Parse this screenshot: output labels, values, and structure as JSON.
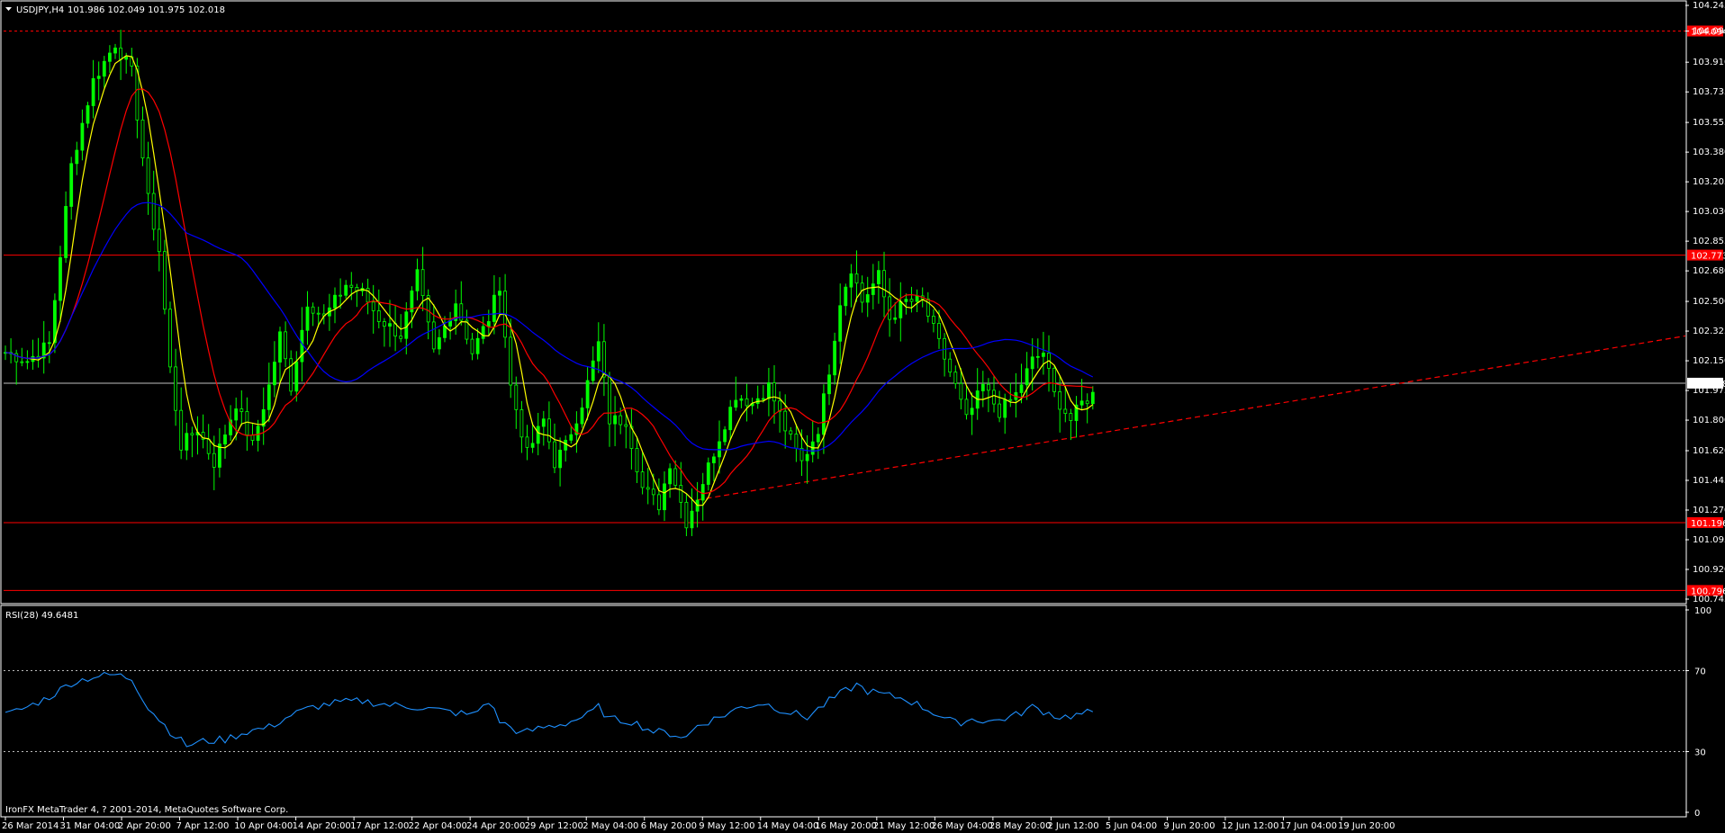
{
  "header": {
    "symbol_label": "USDJPY,H4",
    "ohlc_label": "101.986 102.049 101.975 102.018",
    "menu_icon": "triangle-down-icon"
  },
  "rsi_header": {
    "label": "RSI(28) 49.6481"
  },
  "copyright": "IronFX MetaTrader 4, ? 2001-2014, MetaQuotes Software Corp.",
  "colors": {
    "background": "#000000",
    "axis": "#ffffff",
    "bull_candle": "#00ff00",
    "ma_fast": "#ffff00",
    "ma_mid": "#ff0000",
    "ma_slow": "#0000ff",
    "rsi_line": "#1e90ff",
    "level_line": "#ff0000",
    "price_line": "#c0c0c0"
  },
  "chart_data": [
    {
      "type": "candlestick",
      "symbol": "USDJPY",
      "timeframe": "H4",
      "price_scale": [
        "104.245",
        "104.094",
        "103.910",
        "103.735",
        "103.555",
        "103.380",
        "103.205",
        "103.030",
        "102.855",
        "102.680",
        "102.500",
        "102.325",
        "102.150",
        "101.975",
        "101.800",
        "101.620",
        "101.445",
        "101.270",
        "101.095",
        "100.920",
        "100.745"
      ],
      "ylim": [
        100.745,
        104.245
      ],
      "time_labels": [
        "26 Mar 2014",
        "31 Mar 04:00",
        "2 Apr 20:00",
        "7 Apr 12:00",
        "10 Apr 04:00",
        "14 Apr 20:00",
        "17 Apr 12:00",
        "22 Apr 04:00",
        "24 Apr 20:00",
        "29 Apr 12:00",
        "2 May 04:00",
        "6 May 20:00",
        "9 May 12:00",
        "14 May 04:00",
        "16 May 20:00",
        "21 May 12:00",
        "26 May 04:00",
        "28 May 20:00",
        "2 Jun 12:00",
        "5 Jun 04:00",
        "9 Jun 20:00",
        "12 Jun 12:00",
        "17 Jun 04:00",
        "19 Jun 20:00"
      ],
      "horizontal_levels": [
        {
          "label": "104.094",
          "value": 104.094,
          "style": "dotted"
        },
        {
          "label": "102.773",
          "value": 102.773,
          "style": "solid"
        },
        {
          "label": "101.196",
          "value": 101.196,
          "style": "solid"
        },
        {
          "label": "100.796",
          "value": 100.796,
          "style": "solid"
        }
      ],
      "current_price": {
        "label": "102.018",
        "value": 102.018
      },
      "trendline": {
        "style": "dashed",
        "from": {
          "bar": 126,
          "price": 101.33
        },
        "to": {
          "bar": 247,
          "price": 101.98
        }
      },
      "anchors": [
        [
          0,
          102.2
        ],
        [
          4,
          102.15
        ],
        [
          8,
          102.25
        ],
        [
          12,
          103.3
        ],
        [
          16,
          103.8
        ],
        [
          20,
          104.02
        ],
        [
          23,
          103.85
        ],
        [
          26,
          103.1
        ],
        [
          28,
          102.8
        ],
        [
          30,
          102.1
        ],
        [
          32,
          101.65
        ],
        [
          35,
          101.75
        ],
        [
          38,
          101.55
        ],
        [
          42,
          101.9
        ],
        [
          45,
          101.65
        ],
        [
          48,
          102.0
        ],
        [
          50,
          102.3
        ],
        [
          52,
          102.0
        ],
        [
          55,
          102.5
        ],
        [
          58,
          102.4
        ],
        [
          62,
          102.6
        ],
        [
          65,
          102.55
        ],
        [
          68,
          102.4
        ],
        [
          72,
          102.3
        ],
        [
          75,
          102.65
        ],
        [
          78,
          102.2
        ],
        [
          82,
          102.5
        ],
        [
          85,
          102.2
        ],
        [
          88,
          102.4
        ],
        [
          90,
          102.6
        ],
        [
          92,
          102.0
        ],
        [
          95,
          101.6
        ],
        [
          98,
          101.8
        ],
        [
          100,
          101.55
        ],
        [
          102,
          101.65
        ],
        [
          105,
          101.9
        ],
        [
          108,
          102.25
        ],
        [
          110,
          101.8
        ],
        [
          113,
          101.8
        ],
        [
          116,
          101.4
        ],
        [
          119,
          101.3
        ],
        [
          121,
          101.55
        ],
        [
          124,
          101.2
        ],
        [
          126,
          101.35
        ],
        [
          130,
          101.7
        ],
        [
          133,
          101.95
        ],
        [
          136,
          101.9
        ],
        [
          139,
          102.0
        ],
        [
          142,
          101.75
        ],
        [
          145,
          101.55
        ],
        [
          148,
          101.75
        ],
        [
          150,
          102.1
        ],
        [
          152,
          102.5
        ],
        [
          154,
          102.7
        ],
        [
          156,
          102.5
        ],
        [
          159,
          102.65
        ],
        [
          161,
          102.4
        ],
        [
          164,
          102.5
        ],
        [
          167,
          102.5
        ],
        [
          170,
          102.25
        ],
        [
          173,
          102.0
        ],
        [
          175,
          101.8
        ],
        [
          178,
          102.0
        ],
        [
          181,
          101.85
        ],
        [
          184,
          101.95
        ],
        [
          187,
          102.15
        ],
        [
          189,
          102.2
        ],
        [
          191,
          101.95
        ],
        [
          194,
          101.8
        ],
        [
          196,
          101.9
        ],
        [
          198,
          101.95
        ]
      ],
      "series": [
        {
          "name": "",
          "type": "ma_fast",
          "period_bars": 5
        },
        {
          "name": "",
          "type": "ma_mid",
          "period_bars": 13
        },
        {
          "name": "",
          "type": "ma_slow",
          "period_bars": 34
        }
      ]
    },
    {
      "type": "line",
      "indicator": "RSI",
      "period": 28,
      "last_value": 49.6481,
      "ylim": [
        0,
        100
      ],
      "scale_labels": [
        "100",
        "70",
        "30",
        "0"
      ],
      "levels": [
        70,
        30
      ],
      "anchors": [
        [
          0,
          48
        ],
        [
          4,
          52
        ],
        [
          8,
          57
        ],
        [
          12,
          64
        ],
        [
          16,
          67
        ],
        [
          20,
          68
        ],
        [
          23,
          66
        ],
        [
          26,
          52
        ],
        [
          30,
          40
        ],
        [
          33,
          33
        ],
        [
          36,
          35
        ],
        [
          40,
          36
        ],
        [
          44,
          40
        ],
        [
          48,
          42
        ],
        [
          52,
          48
        ],
        [
          56,
          52
        ],
        [
          60,
          54
        ],
        [
          65,
          55
        ],
        [
          70,
          53
        ],
        [
          75,
          52
        ],
        [
          80,
          50
        ],
        [
          85,
          48
        ],
        [
          88,
          55
        ],
        [
          90,
          45
        ],
        [
          94,
          39
        ],
        [
          98,
          42
        ],
        [
          102,
          44
        ],
        [
          106,
          48
        ],
        [
          108,
          52
        ],
        [
          110,
          46
        ],
        [
          114,
          45
        ],
        [
          118,
          40
        ],
        [
          121,
          39
        ],
        [
          124,
          37
        ],
        [
          126,
          43
        ],
        [
          130,
          47
        ],
        [
          134,
          52
        ],
        [
          138,
          54
        ],
        [
          142,
          50
        ],
        [
          146,
          47
        ],
        [
          150,
          55
        ],
        [
          153,
          60
        ],
        [
          155,
          63
        ],
        [
          157,
          60
        ],
        [
          160,
          58
        ],
        [
          164,
          56
        ],
        [
          167,
          52
        ],
        [
          170,
          48
        ],
        [
          173,
          44
        ],
        [
          176,
          46
        ],
        [
          180,
          45
        ],
        [
          184,
          48
        ],
        [
          187,
          52
        ],
        [
          189,
          50
        ],
        [
          192,
          47
        ],
        [
          195,
          48
        ],
        [
          198,
          49.65
        ]
      ]
    }
  ]
}
